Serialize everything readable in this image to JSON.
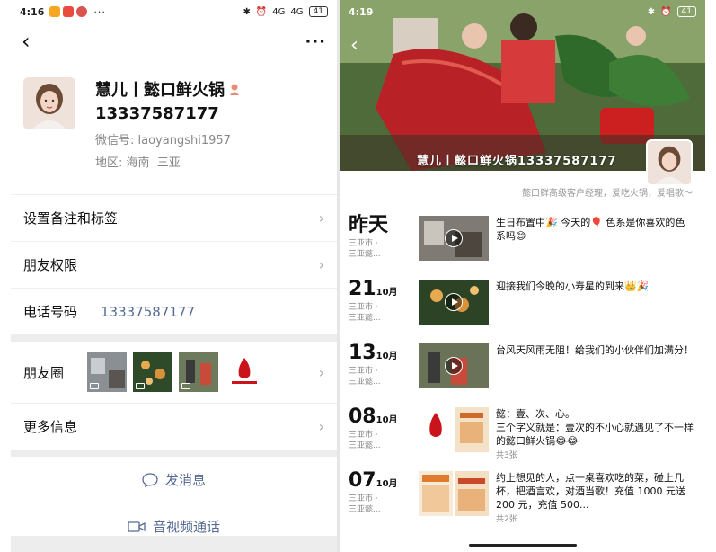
{
  "left": {
    "status": {
      "time": "4:16",
      "dots": "···",
      "battery": "41",
      "signal1": "4G",
      "signal2": "4G"
    },
    "nav": {
      "back": "‹",
      "more": "···"
    },
    "profile": {
      "name": "慧儿丨懿口鲜火锅",
      "phone": "13337587177",
      "wechat_label": "微信号:",
      "wechat_id": "laoyangshi1957",
      "region_label": "地区:",
      "region": "海南  三亚"
    },
    "rows": {
      "remark": "设置备注和标签",
      "permission": "朋友权限",
      "phone_label": "电话号码",
      "phone_value": "13337587177",
      "moments": "朋友圈",
      "more_info": "更多信息"
    },
    "actions": {
      "message": "发消息",
      "call": "音视频通话"
    },
    "colors": {
      "link": "#576b95",
      "bg_gray": "#ededed"
    }
  },
  "right": {
    "status": {
      "time": "4:19",
      "battery": "41"
    },
    "cover_name": "慧儿丨懿口鲜火锅13337587177",
    "signature": "懿口鲜高级客户经理，爱吃火锅，爱唱歌～",
    "posts": [
      {
        "day": "昨天",
        "month": "",
        "loc1": "三亚市 ·",
        "loc2": "三亚懿...",
        "text": "生日布置中🎉 今天的🎈 色系是你喜欢的色系吗😊",
        "count": ""
      },
      {
        "day": "21",
        "month": "10月",
        "loc1": "三亚市 ·",
        "loc2": "三亚懿...",
        "text": "迎接我们今晚的小寿星的到来👑🎉",
        "count": ""
      },
      {
        "day": "13",
        "month": "10月",
        "loc1": "三亚市 ·",
        "loc2": "三亚懿...",
        "text": "台风天风雨无阻！给我们的小伙伴们加满分！",
        "count": ""
      },
      {
        "day": "08",
        "month": "10月",
        "loc1": "三亚市 ·",
        "loc2": "三亚懿...",
        "text": "懿：壹、次、心。\n三个字义就是：壹次的不小心就遇见了不一样的懿口鲜火锅😂😂",
        "count": "共3张"
      },
      {
        "day": "07",
        "month": "10月",
        "loc1": "三亚市 ·",
        "loc2": "三亚懿...",
        "text": "约上想见的人，点一桌喜欢吃的菜，碰上几杯，把酒言欢，对酒当歌！充值 1000 元送 200 元，充值 500...",
        "count": "共2张"
      }
    ]
  }
}
